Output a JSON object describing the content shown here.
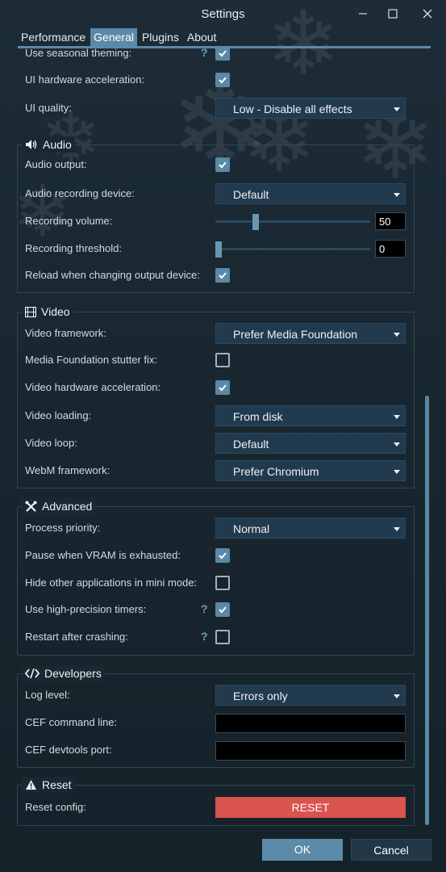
{
  "window": {
    "title": "Settings",
    "minimize_icon": "minimize-icon",
    "maximize_icon": "maximize-icon",
    "close_icon": "close-icon"
  },
  "tabs": [
    {
      "label": "Performance",
      "active": false
    },
    {
      "label": "General",
      "active": true
    },
    {
      "label": "Plugins",
      "active": false
    },
    {
      "label": "About",
      "active": false
    }
  ],
  "appearance": {
    "seasonal_theming": {
      "label": "Use seasonal theming:",
      "help": "?",
      "checked": true
    },
    "ui_hw_accel": {
      "label": "UI hardware acceleration:",
      "checked": true
    },
    "ui_quality": {
      "label": "UI quality:",
      "value": "Low - Disable all effects"
    }
  },
  "audio": {
    "title": "Audio",
    "icon": "speaker-icon",
    "output": {
      "label": "Audio output:",
      "checked": true
    },
    "recording_device": {
      "label": "Audio recording device:",
      "value": "Default"
    },
    "recording_volume": {
      "label": "Recording volume:",
      "value": "50",
      "level": 0.25
    },
    "recording_threshold": {
      "label": "Recording threshold:",
      "value": "0",
      "level": 0.0
    },
    "reload_on_change": {
      "label": "Reload when changing output device:",
      "checked": true
    }
  },
  "video": {
    "title": "Video",
    "icon": "film-icon",
    "framework": {
      "label": "Video framework:",
      "value": "Prefer Media Foundation"
    },
    "mf_stutter_fix": {
      "label": "Media Foundation stutter fix:",
      "checked": false
    },
    "hw_accel": {
      "label": "Video hardware acceleration:",
      "checked": true
    },
    "loading": {
      "label": "Video loading:",
      "value": "From disk"
    },
    "loop": {
      "label": "Video loop:",
      "value": "Default"
    },
    "webm_framework": {
      "label": "WebM framework:",
      "value": "Prefer Chromium"
    }
  },
  "advanced": {
    "title": "Advanced",
    "icon": "tools-icon",
    "process_priority": {
      "label": "Process priority:",
      "value": "Normal"
    },
    "pause_vram": {
      "label": "Pause when VRAM is exhausted:",
      "checked": true
    },
    "hide_mini": {
      "label": "Hide other applications in mini mode:",
      "checked": false
    },
    "hp_timers": {
      "label": "Use high-precision timers:",
      "help": "?",
      "checked": true
    },
    "restart_crash": {
      "label": "Restart after crashing:",
      "help": "?",
      "checked": false
    }
  },
  "developers": {
    "title": "Developers",
    "icon": "code-icon",
    "log_level": {
      "label": "Log level:",
      "value": "Errors only"
    },
    "cef_cmd": {
      "label": "CEF command line:",
      "value": ""
    },
    "cef_port": {
      "label": "CEF devtools port:",
      "value": ""
    }
  },
  "reset": {
    "title": "Reset",
    "icon": "warning-icon",
    "label": "Reset config:",
    "button": "RESET"
  },
  "footer": {
    "ok": "OK",
    "cancel": "Cancel"
  },
  "colors": {
    "accent": "#5a8aa8",
    "reset": "#d9534f",
    "background": "#1a2933"
  }
}
